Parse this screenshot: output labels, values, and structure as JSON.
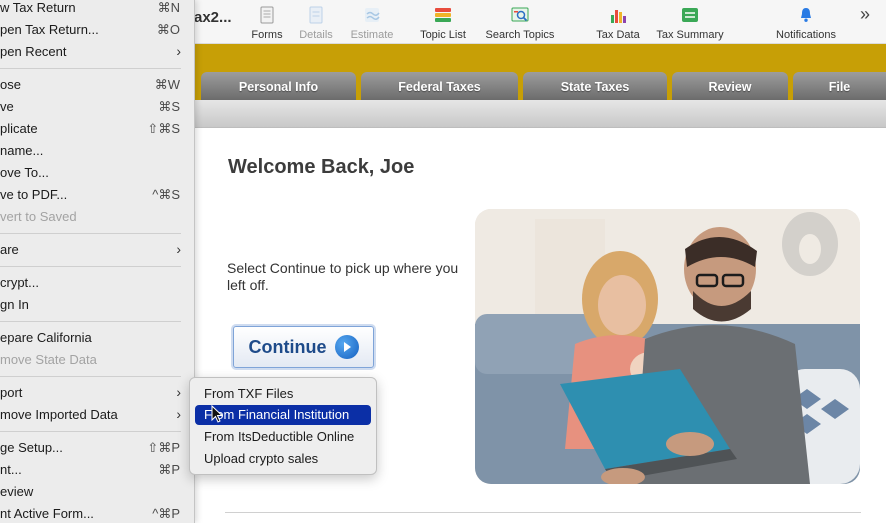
{
  "toolbar": {
    "app_title": "ax2...",
    "tools": [
      {
        "name": "forms",
        "label": "Forms",
        "icon": "forms-icon",
        "enabled": true
      },
      {
        "name": "details",
        "label": "Details",
        "icon": "details-icon",
        "enabled": false
      },
      {
        "name": "estimate",
        "label": "Estimate",
        "icon": "estimate-icon",
        "enabled": false
      },
      {
        "name": "topic-list",
        "label": "Topic List",
        "icon": "topic-list-icon",
        "enabled": true
      },
      {
        "name": "search-topics",
        "label": "Search Topics",
        "icon": "search-topics-icon",
        "enabled": true
      },
      {
        "name": "tax-data",
        "label": "Tax Data",
        "icon": "tax-data-icon",
        "enabled": true
      },
      {
        "name": "tax-summary",
        "label": "Tax Summary",
        "icon": "tax-summary-icon",
        "enabled": true
      },
      {
        "name": "notifications",
        "label": "Notifications",
        "icon": "bell-icon",
        "enabled": true
      }
    ],
    "more_glyph": "»"
  },
  "tabs": [
    "Personal Info",
    "Federal Taxes",
    "State Taxes",
    "Review",
    "File"
  ],
  "main": {
    "welcome": "Welcome Back, Joe",
    "instructions": "Select Continue to pick up where you left off.",
    "continue_label": "Continue"
  },
  "file_menu": {
    "items": [
      {
        "label": "w Tax Return",
        "shortcut": "⌘N",
        "enabled": true
      },
      {
        "label": "pen Tax Return...",
        "shortcut": "⌘O",
        "enabled": true
      },
      {
        "label": "pen Recent",
        "shortcut": "",
        "submenu": true,
        "enabled": true
      },
      {
        "label": "ose",
        "shortcut": "⌘W",
        "enabled": true
      },
      {
        "label": "ve",
        "shortcut": "⌘S",
        "enabled": true
      },
      {
        "label": "plicate",
        "shortcut": "⇧⌘S",
        "enabled": true
      },
      {
        "label": "name...",
        "shortcut": "",
        "enabled": true
      },
      {
        "label": "ove To...",
        "shortcut": "",
        "enabled": true
      },
      {
        "label": "ve to PDF...",
        "shortcut": "^⌘S",
        "enabled": true
      },
      {
        "label": "vert to Saved",
        "shortcut": "",
        "enabled": false
      },
      {
        "label": "are",
        "shortcut": "",
        "submenu": true,
        "enabled": true
      },
      {
        "label": "crypt...",
        "shortcut": "",
        "enabled": true
      },
      {
        "label": "gn In",
        "shortcut": "",
        "enabled": true
      },
      {
        "label": "epare California",
        "shortcut": "",
        "enabled": true
      },
      {
        "label": "move State Data",
        "shortcut": "",
        "enabled": false
      },
      {
        "label": "port",
        "shortcut": "",
        "submenu": true,
        "enabled": true
      },
      {
        "label": "move Imported Data",
        "shortcut": "",
        "submenu": true,
        "enabled": true
      },
      {
        "label": "ge Setup...",
        "shortcut": "⇧⌘P",
        "enabled": true
      },
      {
        "label": "nt...",
        "shortcut": "⌘P",
        "enabled": true
      },
      {
        "label": "eview",
        "shortcut": "",
        "enabled": true
      },
      {
        "label": "nt Active Form...",
        "shortcut": "^⌘P",
        "enabled": true
      }
    ]
  },
  "import_submenu": {
    "items": [
      {
        "label": "From TXF Files",
        "selected": false
      },
      {
        "label": "From Financial Institution",
        "selected": true
      },
      {
        "label": "From ItsDeductible Online",
        "selected": false
      },
      {
        "label": "Upload crypto sales",
        "selected": false
      }
    ]
  },
  "colors": {
    "tab_bar": "#c79f06",
    "tab": "#7d7d7d",
    "menu_bg": "#ececec",
    "selection": "#0b2fa6",
    "continue_text": "#1e4b8a",
    "continue_arrow": "#1a6fd1"
  }
}
